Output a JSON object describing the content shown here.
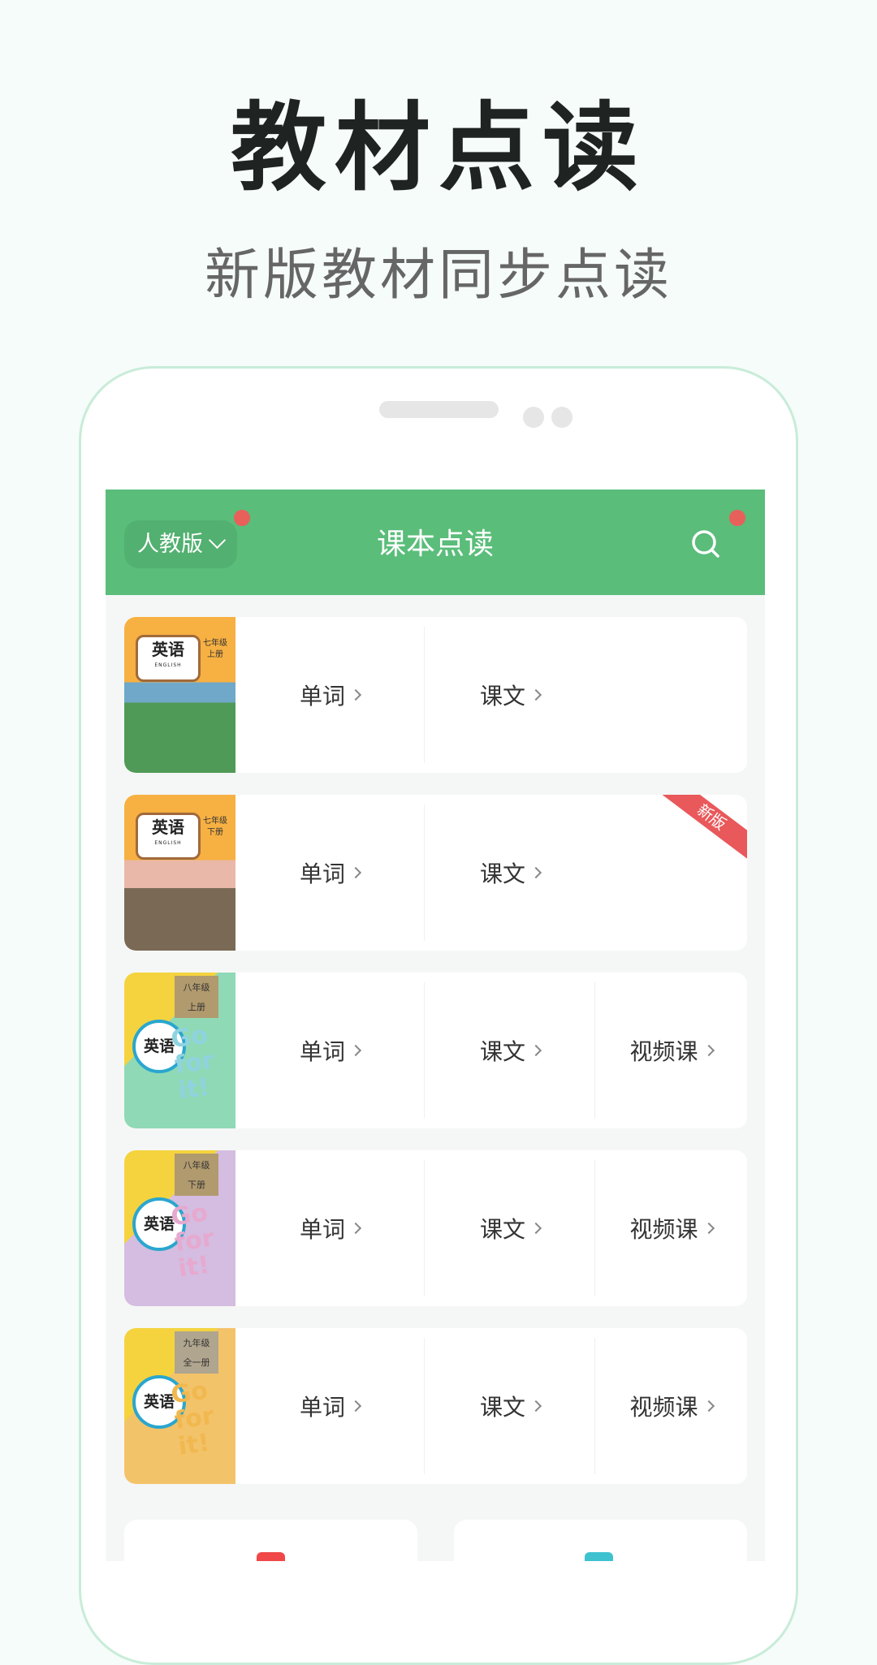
{
  "hero": {
    "title": "教材点读",
    "subtitle": "新版教材同步点读"
  },
  "header": {
    "edition": "人教版",
    "title": "课本点读"
  },
  "books": [
    {
      "subject": "英语",
      "english": "ENGLISH",
      "grade": "七年级",
      "volume": "上册",
      "items": [
        "单词",
        "课文"
      ],
      "badge": null
    },
    {
      "subject": "英语",
      "english": "ENGLISH",
      "grade": "七年级",
      "volume": "下册",
      "items": [
        "单词",
        "课文"
      ],
      "badge": "新版"
    },
    {
      "subject": "英语",
      "series": "Go for it!",
      "grade": "八年级",
      "volume": "上册",
      "items": [
        "单词",
        "课文",
        "视频课"
      ]
    },
    {
      "subject": "英语",
      "series": "Go for it!",
      "grade": "八年级",
      "volume": "下册",
      "items": [
        "单词",
        "课文",
        "视频课"
      ]
    },
    {
      "subject": "英语",
      "series": "Go for it!",
      "grade": "九年级",
      "volume": "全一册",
      "items": [
        "单词",
        "课文",
        "视频课"
      ]
    }
  ],
  "colors": {
    "brand_green": "#5abd7a",
    "notify_red": "#e8605a",
    "ribbon_red": "#e9585a",
    "icon_red": "#f04848",
    "icon_teal": "#3ec2d0"
  }
}
